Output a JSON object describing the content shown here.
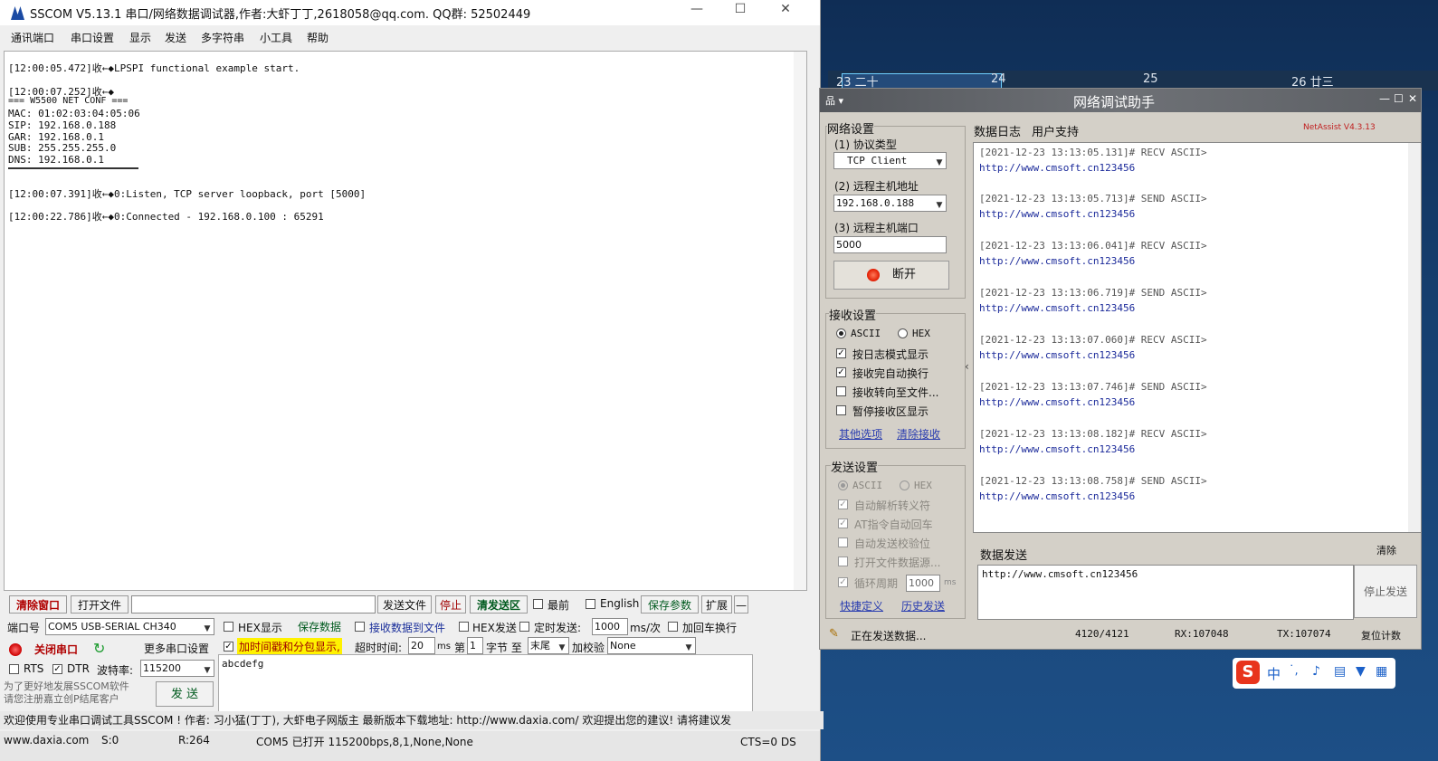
{
  "sscom": {
    "title": "SSCOM V5.13.1 串口/网络数据调试器,作者:大虾丁丁,2618058@qq.com. QQ群: 52502449",
    "window_controls": {
      "minimize": "—",
      "maximize": "☐",
      "close": "✕"
    },
    "menu": [
      "通讯端口",
      "串口设置",
      "显示",
      "发送",
      "多字符串",
      "小工具",
      "帮助"
    ],
    "receive_lines": [
      "[12:00:05.472]收←◆LPSPI functional example start.",
      "[12:00:07.252]收←◆",
      "=== W5500 NET CONF ===",
      "MAC: 01:02:03:04:05:06",
      "SIP: 192.168.0.188",
      "GAR: 192.168.0.1",
      "SUB: 255.255.255.0",
      "DNS: 192.168.0.1",
      "[12:00:07.391]收←◆0:Listen, TCP server loopback, port [5000]",
      "[12:00:22.786]收←◆0:Connected - 192.168.0.100 : 65291"
    ],
    "toolbar1": {
      "clear_window": "清除窗口",
      "open_file": "打开文件",
      "send_file": "发送文件",
      "stop": "停止",
      "clear_send": "清发送区",
      "topmost": "最前",
      "english": "English",
      "save_params": "保存参数",
      "expand": "扩展",
      "collapse": "—"
    },
    "port": {
      "label": "端口号",
      "value": "COM5 USB-SERIAL CH340",
      "close_button": "关闭串口",
      "more_settings": "更多串口设置",
      "rts": "RTS",
      "dtr": "DTR",
      "baud_label": "波特率:",
      "baud_value": "115200"
    },
    "options": {
      "hex_display": "HEX显示",
      "save_data": "保存数据",
      "recv_to_file": "接收数据到文件",
      "hex_send": "HEX发送",
      "timed_send": "定时发送:",
      "interval": "1000",
      "interval_unit": "ms/次",
      "add_crlf": "加回车换行",
      "timestamp": "加时间戳和分包显示,",
      "timeout_label": "超时时间:",
      "timeout_value": "20",
      "timeout_unit": "ms",
      "nth_label": "第",
      "nth_value": "1",
      "byte_label": "字节 至",
      "end_value": "末尾",
      "checksum_label": "加校验",
      "checksum_value": "None"
    },
    "send_text": "abcdefg",
    "send_button": "发 送",
    "promo": "为了更好地发展SSCOM软件\n请您注册嘉立创P结尾客户",
    "ticker": "欢迎使用专业串口调试工具SSCOM ! 作者: 习小猛(丁丁), 大虾电子网版主 最新版本下载地址: http://www.daxia.com/ 欢迎提出您的建议! 请将建议发",
    "status": {
      "site": "www.daxia.com",
      "sent": "S:0",
      "received": "R:264",
      "port_status": "COM5 已打开 115200bps,8,1,None,None",
      "cts": "CTS=0 DS"
    }
  },
  "desktop": {
    "calendar_days": [
      "23 二十",
      "24",
      "25",
      "26 廿三"
    ]
  },
  "netassist": {
    "title": "网络调试助手",
    "menu_icon": "品 ▾",
    "version": "NetAssist V4.3.13",
    "net_settings": {
      "label": "网络设置",
      "protocol_label": "(1) 协议类型",
      "protocol_value": "TCP Client",
      "host_label": "(2) 远程主机地址",
      "host_value": "192.168.0.188",
      "port_label": "(3) 远程主机端口",
      "port_value": "5000",
      "disconnect": "断开"
    },
    "recv_settings": {
      "label": "接收设置",
      "ascii": "ASCII",
      "hex": "HEX",
      "log_mode": "按日志模式显示",
      "auto_wrap": "接收完自动换行",
      "to_file": "接收转向至文件...",
      "pause": "暂停接收区显示",
      "more": "其他选项",
      "clear": "清除接收"
    },
    "send_settings": {
      "label": "发送设置",
      "ascii": "ASCII",
      "hex": "HEX",
      "escape": "自动解析转义符",
      "at_crlf": "AT指令自动回车",
      "checksum": "自动发送校验位",
      "file_source": "打开文件数据源...",
      "cycle": "循环周期",
      "cycle_value": "1000",
      "cycle_unit": "ms",
      "shortcut": "快捷定义",
      "history": "历史发送"
    },
    "tabs": [
      "数据日志",
      "用户支持"
    ],
    "log": [
      {
        "header": "[2021-12-23 13:13:05.131]# RECV ASCII>",
        "data": "http://www.cmsoft.cn123456"
      },
      {
        "header": "[2021-12-23 13:13:05.713]# SEND ASCII>",
        "data": "http://www.cmsoft.cn123456"
      },
      {
        "header": "[2021-12-23 13:13:06.041]# RECV ASCII>",
        "data": "http://www.cmsoft.cn123456"
      },
      {
        "header": "[2021-12-23 13:13:06.719]# SEND ASCII>",
        "data": "http://www.cmsoft.cn123456"
      },
      {
        "header": "[2021-12-23 13:13:07.060]# RECV ASCII>",
        "data": "http://www.cmsoft.cn123456"
      },
      {
        "header": "[2021-12-23 13:13:07.746]# SEND ASCII>",
        "data": "http://www.cmsoft.cn123456"
      },
      {
        "header": "[2021-12-23 13:13:08.182]# RECV ASCII>",
        "data": "http://www.cmsoft.cn123456"
      },
      {
        "header": "[2021-12-23 13:13:08.758]# SEND ASCII>",
        "data": "http://www.cmsoft.cn123456"
      }
    ],
    "send_label": "数据发送",
    "clear_label": "清除",
    "send_text": "http://www.cmsoft.cn123456",
    "stop_send": "停止发送",
    "status": {
      "sending": "正在发送数据...",
      "count": "4120/4121",
      "rx": "RX:107048",
      "tx": "TX:107074",
      "reset": "复位计数"
    }
  },
  "ime": {
    "lang": "中"
  }
}
